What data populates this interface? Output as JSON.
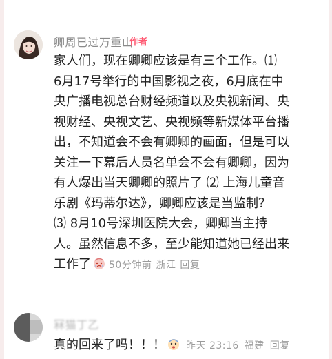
{
  "comments": [
    {
      "author": "卿周已过万重山",
      "badge": "作者",
      "lines": [
        "家人们，现在卿卿应该是有三个工作。⑴",
        "6月17号举行的中国影视之夜，6月底在中",
        "央广播电视总台财经频道以及央视新闻、央",
        "视财经、央视文艺、央视频等新媒体平台播",
        "出，不知道会不会有卿卿的画面，但是可以",
        "关注一下幕后人员名单会不会有卿卿，因为",
        "有人爆出当天卿卿的照片了 ⑵ 上海儿童音",
        "乐剧《玛蒂尔达》，卿卿应该是当监制？",
        "⑶ 8月10号深圳医院大会，卿卿当主持",
        "人。虽然信息不多，至少能知道她已经出来",
        "工作了"
      ],
      "time": "50分钟前",
      "location": "浙江",
      "reply_label": "回复"
    },
    {
      "author": "冧猫丁乙",
      "text": "真的回来了吗！！！",
      "time": "昨天 23:16",
      "location": "福建",
      "reply_label": "回复"
    }
  ]
}
